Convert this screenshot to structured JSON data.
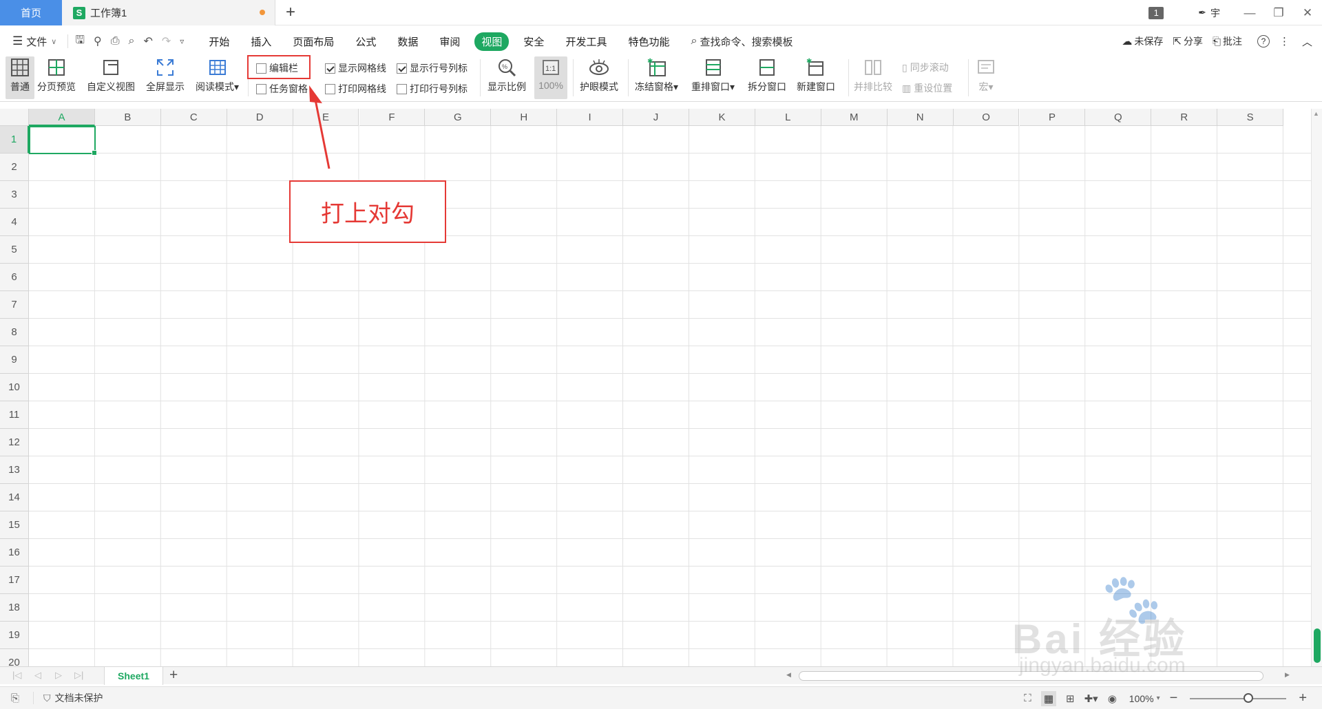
{
  "titlebar": {
    "home_tab": "首页",
    "doc_icon": "S",
    "doc_title": "工作簿1",
    "new_tab": "+",
    "badge": "1",
    "user": "宇",
    "min": "—",
    "restore": "❐",
    "close": "✕"
  },
  "menu": {
    "hamburger": "☰",
    "file": "文件",
    "tabs": [
      "开始",
      "插入",
      "页面布局",
      "公式",
      "数据",
      "审阅",
      "视图",
      "安全",
      "开发工具",
      "特色功能"
    ],
    "active_tab": "视图",
    "search": "查找命令、搜索模板",
    "unsaved": "未保存",
    "share": "分享",
    "comment": "批注",
    "help": "?"
  },
  "ribbon": {
    "normal": "普通",
    "page_break": "分页预览",
    "custom_view": "自定义视图",
    "fullscreen": "全屏显示",
    "reading": "阅读模式",
    "edit_bar": "编辑栏",
    "task_pane": "任务窗格",
    "show_grid": "显示网格线",
    "show_headers": "显示行号列标",
    "print_grid": "打印网格线",
    "print_headers": "打印行号列标",
    "zoom": "显示比例",
    "zoom_100": "100%",
    "eye": "护眼模式",
    "freeze": "冻结窗格",
    "arrange": "重排窗口",
    "split": "拆分窗口",
    "new_window": "新建窗口",
    "side_by_side": "并排比较",
    "sync_scroll": "同步滚动",
    "reset_pos": "重设位置",
    "macro": "宏",
    "checks": {
      "edit_bar": false,
      "task_pane": false,
      "show_grid": true,
      "show_headers": true,
      "print_grid": false,
      "print_headers": false
    }
  },
  "grid": {
    "columns": [
      "A",
      "B",
      "C",
      "D",
      "E",
      "F",
      "G",
      "H",
      "I",
      "J",
      "K",
      "L",
      "M",
      "N",
      "O",
      "P",
      "Q",
      "R",
      "S"
    ],
    "rows": [
      "1",
      "2",
      "3",
      "4",
      "5",
      "6",
      "7",
      "8",
      "9",
      "10",
      "11",
      "12",
      "13",
      "14",
      "15",
      "16",
      "17",
      "18",
      "19",
      "20"
    ],
    "active_cell": "A1"
  },
  "sheets": {
    "tab": "Sheet1",
    "add": "+"
  },
  "status": {
    "protect": "文档未保护",
    "zoom": "100%",
    "minus": "−",
    "plus": "+"
  },
  "annotation": {
    "note": "打上对勾"
  },
  "watermark": {
    "brand": "Bai 经验",
    "url": "jingyan.baidu.com"
  },
  "colors": {
    "accent": "#1ea861",
    "home_tab": "#4a8fe7",
    "annotation": "#e53935"
  }
}
